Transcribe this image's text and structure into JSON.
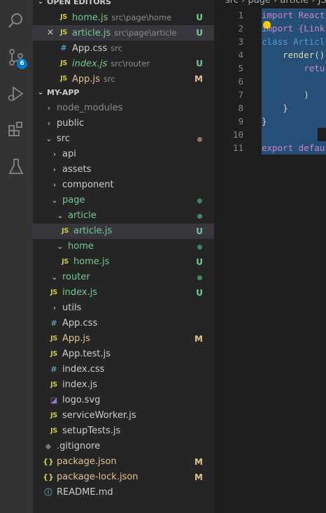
{
  "sidebar": {
    "open_editors_title": "OPEN EDITORS",
    "open_editors": [
      {
        "icon": "JS",
        "name": "home.js",
        "desc": "src\\page\\home",
        "status": "U"
      },
      {
        "icon": "JS",
        "name": "article.js",
        "desc": "src\\page\\article",
        "status": "U",
        "selected": true,
        "close": "×"
      },
      {
        "icon": "#",
        "name": "App.css",
        "desc": "src",
        "status": ""
      },
      {
        "icon": "JS",
        "name": "index.js",
        "desc": "src\\router",
        "status": "U"
      },
      {
        "icon": "JS",
        "name": "App.js",
        "desc": "src",
        "status": "M"
      }
    ],
    "project_title": "MY-APP",
    "tree": [
      {
        "type": "folder",
        "chev": "›",
        "name": "node_modules"
      },
      {
        "type": "folder",
        "chev": "›",
        "name": "public"
      },
      {
        "type": "folder",
        "chev": "⌄",
        "name": "src"
      },
      {
        "type": "folder",
        "chev": "›",
        "name": "api"
      },
      {
        "type": "folder",
        "chev": "›",
        "name": "assets"
      },
      {
        "type": "folder",
        "chev": "›",
        "name": "component"
      },
      {
        "type": "folder",
        "chev": "⌄",
        "name": "page"
      },
      {
        "type": "folder",
        "chev": "⌄",
        "name": "article"
      },
      {
        "type": "file",
        "icon": "JS",
        "name": "article.js",
        "status": "U"
      },
      {
        "type": "folder",
        "chev": "⌄",
        "name": "home"
      },
      {
        "type": "file",
        "icon": "JS",
        "name": "home.js",
        "status": "U"
      },
      {
        "type": "folder",
        "chev": "⌄",
        "name": "router"
      },
      {
        "type": "file",
        "icon": "JS",
        "name": "index.js",
        "status": "U"
      },
      {
        "type": "folder",
        "chev": "›",
        "name": "utils"
      },
      {
        "type": "file",
        "icon": "#",
        "name": "App.css"
      },
      {
        "type": "file",
        "icon": "JS",
        "name": "App.js",
        "status": "M"
      },
      {
        "type": "file",
        "icon": "JS",
        "name": "App.test.js"
      },
      {
        "type": "file",
        "icon": "#",
        "name": "index.css"
      },
      {
        "type": "file",
        "icon": "JS",
        "name": "index.js"
      },
      {
        "type": "file",
        "icon": "◪",
        "name": "logo.svg"
      },
      {
        "type": "file",
        "icon": "JS",
        "name": "serviceWorker.js"
      },
      {
        "type": "file",
        "icon": "JS",
        "name": "setupTests.js"
      },
      {
        "type": "file",
        "icon": "◆",
        "name": ".gitignore"
      },
      {
        "type": "file",
        "icon": "{}",
        "name": "package.json",
        "status": "M"
      },
      {
        "type": "file",
        "icon": "{}",
        "name": "package-lock.json",
        "status": "M"
      },
      {
        "type": "file",
        "icon": "ⓘ",
        "name": "README.md"
      }
    ]
  },
  "activity": {
    "scm_badge": "6",
    "icons": [
      "search-icon",
      "source-control-icon",
      "run-debug-icon",
      "extensions-icon",
      "testing-icon"
    ]
  },
  "editor": {
    "breadcrumb": "src › page › article › JS",
    "lines": [
      {
        "n": "1",
        "text": "import React"
      },
      {
        "n": "2",
        "text": "import {Link"
      },
      {
        "n": "3",
        "text": "class Articl"
      },
      {
        "n": "4",
        "text": "    render()"
      },
      {
        "n": "5",
        "text": "        retu"
      },
      {
        "n": "6",
        "text": ""
      },
      {
        "n": "7",
        "text": "        )"
      },
      {
        "n": "8",
        "text": "    }"
      },
      {
        "n": "9",
        "text": "}"
      },
      {
        "n": "10",
        "text": ""
      },
      {
        "n": "11",
        "text": "export defau"
      }
    ]
  },
  "colors": {
    "untracked": "#73c991",
    "modified": "#e2c08d",
    "selection": "#264f78",
    "accent": "#007acc"
  }
}
